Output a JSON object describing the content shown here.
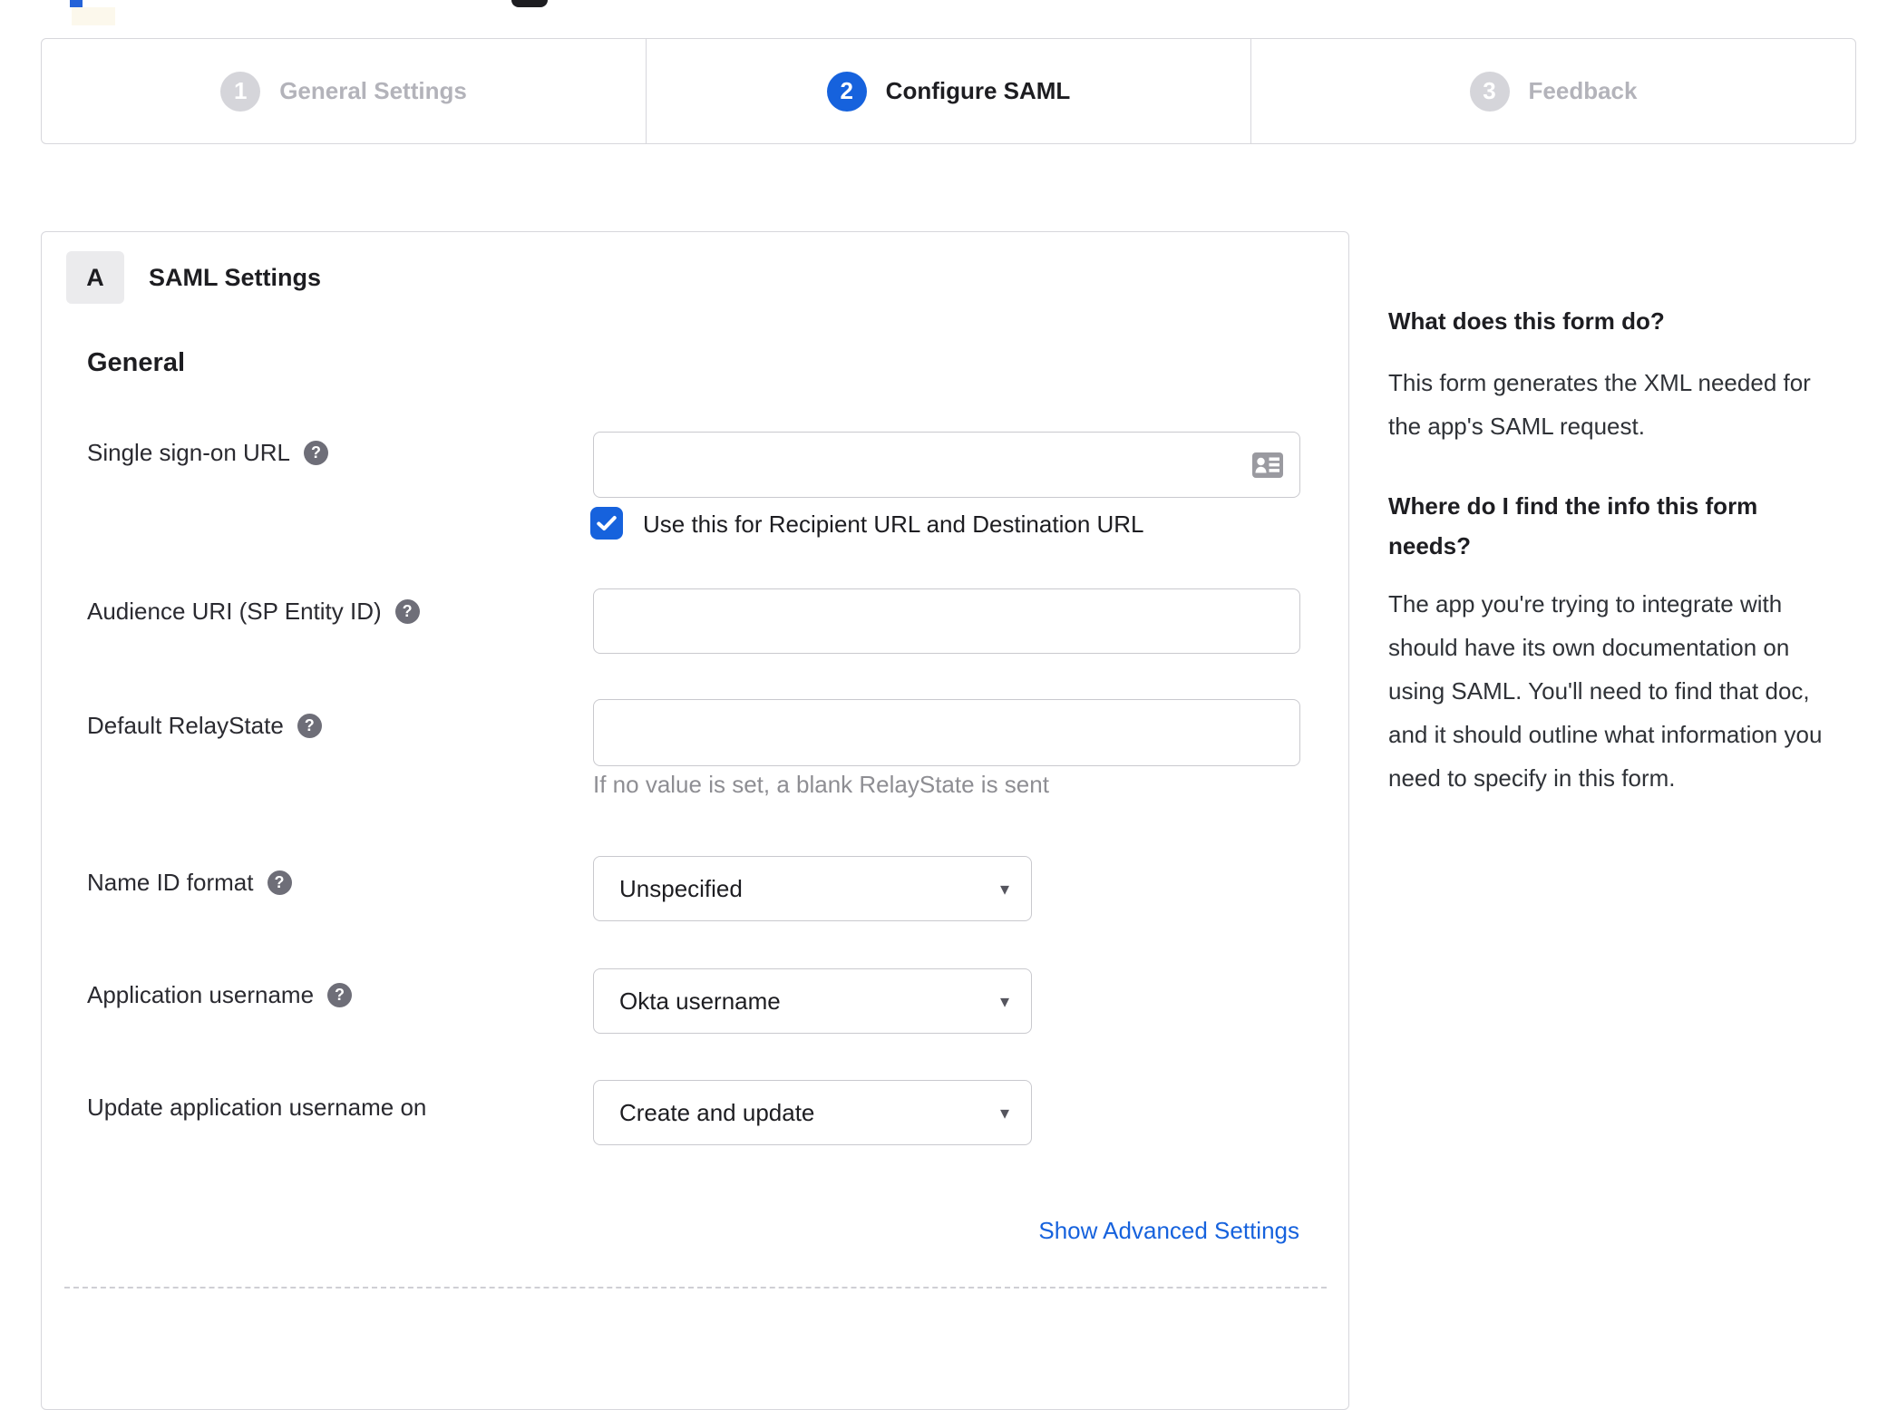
{
  "stepper": {
    "steps": [
      {
        "number": "1",
        "label": "General Settings",
        "state": "inactive"
      },
      {
        "number": "2",
        "label": "Configure SAML",
        "state": "active"
      },
      {
        "number": "3",
        "label": "Feedback",
        "state": "inactive"
      }
    ]
  },
  "form": {
    "section_badge": "A",
    "section_title": "SAML Settings",
    "group_title": "General",
    "fields": {
      "sso": {
        "label": "Single sign-on URL",
        "value": "",
        "checkbox_label": "Use this for Recipient URL and Destination URL",
        "checked": true
      },
      "audience": {
        "label": "Audience URI (SP Entity ID)",
        "value": ""
      },
      "relay": {
        "label": "Default RelayState",
        "value": "",
        "hint": "If no value is set, a blank RelayState is sent"
      },
      "nameid": {
        "label": "Name ID format",
        "value": "Unspecified"
      },
      "appuser": {
        "label": "Application username",
        "value": "Okta username"
      },
      "updateuser": {
        "label": "Update application username on",
        "value": "Create and update"
      }
    },
    "advanced_link": "Show Advanced Settings"
  },
  "help": {
    "q1": "What does this form do?",
    "a1": "This form generates the XML needed for the app's SAML request.",
    "q2": "Where do I find the info this form needs?",
    "a2": "The app you're trying to integrate with should have its own documentation on using SAML. You'll need to find that doc, and it should outline what information you need to specify in this form."
  },
  "icons": {
    "help_glyph": "?",
    "dropdown_glyph": "▾"
  },
  "colors": {
    "accent": "#1662dd",
    "inactive_grey": "#d5d5da",
    "border_grey": "#d7d7dc"
  }
}
